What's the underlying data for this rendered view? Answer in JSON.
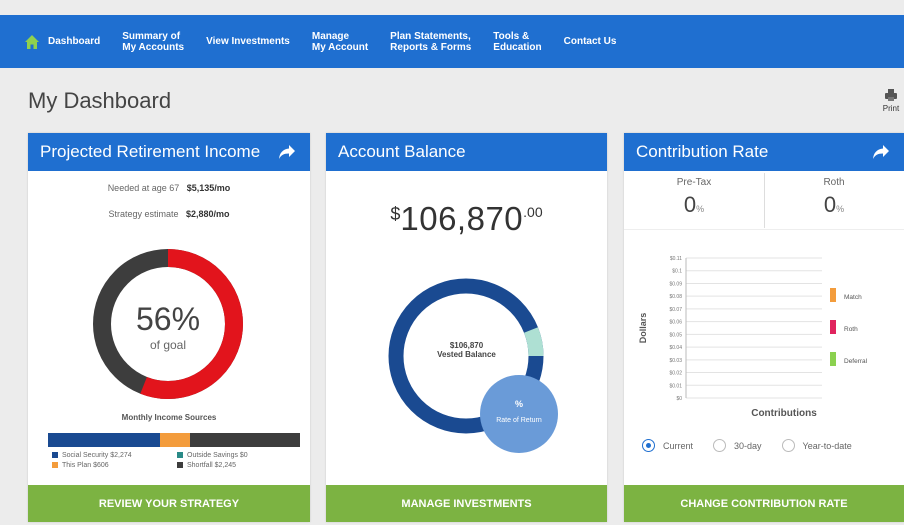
{
  "nav": {
    "items": [
      {
        "label": "Dashboard",
        "active": true
      },
      {
        "label": "Summary of\nMy Accounts"
      },
      {
        "label": "View Investments"
      },
      {
        "label": "Manage\nMy Account"
      },
      {
        "label": "Plan Statements,\nReports & Forms"
      },
      {
        "label": "Tools &\nEducation"
      },
      {
        "label": "Contact Us"
      }
    ]
  },
  "page": {
    "title": "My Dashboard",
    "print_label": "Print"
  },
  "retirement": {
    "title": "Projected Retirement Income",
    "needed_label": "Needed at age 67",
    "needed_value": "$5,135/mo",
    "strategy_label": "Strategy estimate",
    "strategy_value": "$2,880/mo",
    "percent": "56%",
    "percent_value": 56,
    "goal_label": "of goal",
    "sources_title": "Monthly Income Sources",
    "sources": [
      {
        "label": "Social Security $2,274",
        "color": "#1a4a91",
        "value": 2274
      },
      {
        "label": "Outside Savings $0",
        "color": "#2a8a87",
        "value": 0
      },
      {
        "label": "This Plan $606",
        "color": "#f39c3c",
        "value": 606
      },
      {
        "label": "Shortfall $2,245",
        "color": "#3d3d3d",
        "value": 2245
      }
    ],
    "button": "REVIEW YOUR STRATEGY",
    "colors": {
      "progress": "#e2141c",
      "remaining": "#3d3d3d"
    }
  },
  "balance": {
    "title": "Account Balance",
    "dollar_sign": "$",
    "amount": "106,870",
    "cents": ".00",
    "vested_amount": "$106,870",
    "vested_label": "Vested Balance",
    "ror_value": "%",
    "ror_label": "Rate of Return",
    "button": "MANAGE INVESTMENTS",
    "colors": {
      "ring": "#1a4a91",
      "accent": "#aee0d3",
      "bubble": "#6a9bd8"
    }
  },
  "contribution": {
    "title": "Contribution Rate",
    "pretax_label": "Pre-Tax",
    "pretax_value": "0",
    "roth_label": "Roth",
    "roth_value": "0",
    "unit": "%",
    "button": "CHANGE CONTRIBUTION RATE",
    "radios": [
      {
        "label": "Current",
        "selected": true
      },
      {
        "label": "30-day",
        "selected": false
      },
      {
        "label": "Year-to-date",
        "selected": false
      }
    ]
  },
  "chart_data": {
    "type": "bar",
    "xlabel": "Contributions",
    "ylabel": "Dollars",
    "ticks": [
      "$0.11",
      "$0.1",
      "$0.09",
      "$0.08",
      "$0.07",
      "$0.06",
      "$0.05",
      "$0.04",
      "$0.03",
      "$0.02",
      "$0.01",
      "$0"
    ],
    "ylim": [
      0,
      0.11
    ],
    "grid": true,
    "legend_position": "right",
    "series": [
      {
        "name": "Match",
        "values": [
          0
        ],
        "color": "#f39c3c"
      },
      {
        "name": "Roth",
        "values": [
          0
        ],
        "color": "#e0245e"
      },
      {
        "name": "Deferral",
        "values": [
          0
        ],
        "color": "#8bd14f"
      }
    ]
  }
}
